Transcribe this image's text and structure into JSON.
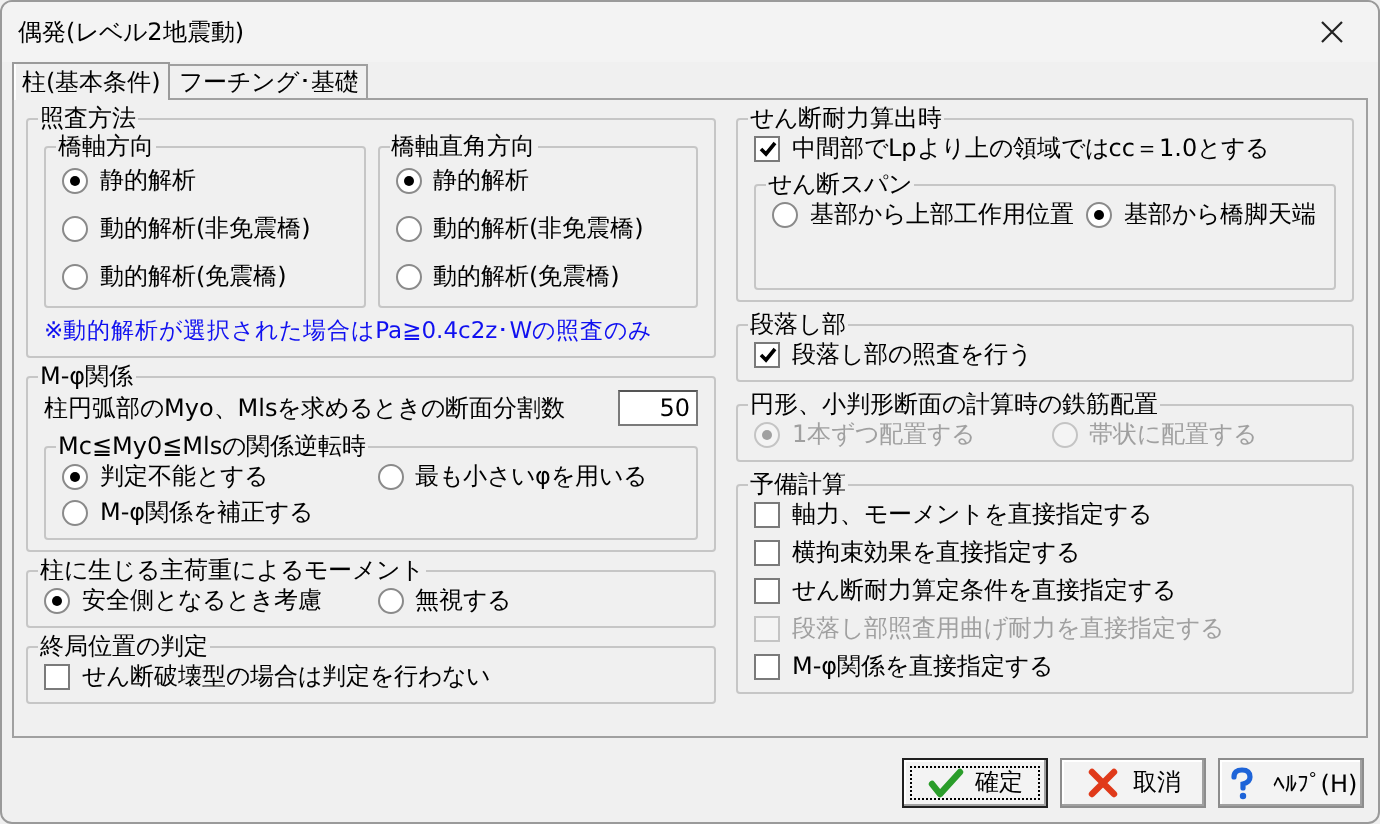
{
  "window": {
    "title": "偶発(レベル2地震動)"
  },
  "tabs": [
    {
      "label": "柱(基本条件)",
      "selected": true
    },
    {
      "label": "フーチング･基礎",
      "selected": false
    }
  ],
  "left": [
    {
      "title": "照査方法",
      "controls": [
        {
          "kind": "group",
          "title": "橋軸方向",
          "controls": [
            {
              "kind": "radio",
              "label": "静的解析",
              "selected": true,
              "disabled": false
            },
            {
              "kind": "radio",
              "label": "動的解析(非免震橋)",
              "selected": false,
              "disabled": false
            },
            {
              "kind": "radio",
              "label": "動的解析(免震橋)",
              "selected": false,
              "disabled": false
            }
          ]
        },
        {
          "kind": "group",
          "title": "橋軸直角方向",
          "controls": [
            {
              "kind": "radio",
              "label": "静的解析",
              "selected": true,
              "disabled": false
            },
            {
              "kind": "radio",
              "label": "動的解析(非免震橋)",
              "selected": false,
              "disabled": false
            },
            {
              "kind": "radio",
              "label": "動的解析(免震橋)",
              "selected": false,
              "disabled": false
            }
          ]
        },
        {
          "kind": "note",
          "text": "※動的解析が選択された場合はPa≧0.4c2z･Wの照査のみ"
        }
      ]
    },
    {
      "title": "M-φ関係",
      "controls": [
        {
          "kind": "number",
          "label": "柱円弧部のMyo、Mlsを求めるときの断面分割数",
          "value": "50"
        },
        {
          "kind": "group",
          "title": "Mc≦My0≦Mlsの関係逆転時",
          "controls": [
            {
              "kind": "radio",
              "label": "判定不能とする",
              "selected": true,
              "disabled": false
            },
            {
              "kind": "radio",
              "label": "最も小さいφを用いる",
              "selected": false,
              "disabled": false
            },
            {
              "kind": "radio",
              "label": "M-φ関係を補正する",
              "selected": false,
              "disabled": false
            }
          ]
        }
      ]
    },
    {
      "title": "柱に生じる主荷重によるモーメント",
      "controls": [
        {
          "kind": "radio",
          "label": "安全側となるとき考慮",
          "selected": true,
          "disabled": false
        },
        {
          "kind": "radio",
          "label": "無視する",
          "selected": false,
          "disabled": false
        }
      ]
    },
    {
      "title": "終局位置の判定",
      "controls": [
        {
          "kind": "checkbox",
          "label": "せん断破壊型の場合は判定を行わない",
          "checked": false,
          "disabled": false
        }
      ]
    }
  ],
  "right": [
    {
      "title": "せん断耐力算出時",
      "controls": [
        {
          "kind": "checkbox",
          "label": "中間部でLpより上の領域ではcc＝1.0とする",
          "checked": true,
          "disabled": false
        },
        {
          "kind": "group",
          "title": "せん断スパン",
          "controls": [
            {
              "kind": "radio",
              "label": "基部から上部工作用位置",
              "selected": false,
              "disabled": false
            },
            {
              "kind": "radio",
              "label": "基部から橋脚天端",
              "selected": true,
              "disabled": false
            }
          ]
        }
      ]
    },
    {
      "title": "段落し部",
      "controls": [
        {
          "kind": "checkbox",
          "label": "段落し部の照査を行う",
          "checked": true,
          "disabled": false
        }
      ]
    },
    {
      "title": "円形、小判形断面の計算時の鉄筋配置",
      "controls": [
        {
          "kind": "radio",
          "label": "1本ずつ配置する",
          "selected": true,
          "disabled": true
        },
        {
          "kind": "radio",
          "label": "帯状に配置する",
          "selected": false,
          "disabled": true
        }
      ]
    },
    {
      "title": "予備計算",
      "controls": [
        {
          "kind": "checkbox",
          "label": "軸力、モーメントを直接指定する",
          "checked": false,
          "disabled": false
        },
        {
          "kind": "checkbox",
          "label": "横拘束効果を直接指定する",
          "checked": false,
          "disabled": false
        },
        {
          "kind": "checkbox",
          "label": "せん断耐力算定条件を直接指定する",
          "checked": false,
          "disabled": false
        },
        {
          "kind": "checkbox",
          "label": "段落し部照査用曲げ耐力を直接指定する",
          "checked": false,
          "disabled": true
        },
        {
          "kind": "checkbox",
          "label": "M-φ関係を直接指定する",
          "checked": false,
          "disabled": false
        }
      ]
    }
  ],
  "buttons": [
    {
      "label": "確定",
      "kind": "ok",
      "focused": true
    },
    {
      "label": "取消",
      "kind": "cancel",
      "focused": false
    },
    {
      "label": "ﾍﾙﾌﾟ(H)",
      "kind": "help",
      "focused": false
    }
  ]
}
